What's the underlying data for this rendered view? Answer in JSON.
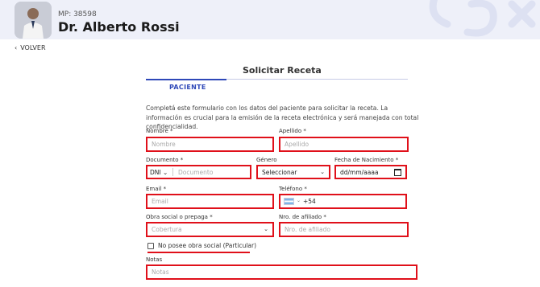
{
  "header": {
    "mp": "MP: 38598",
    "doctor_name": "Dr. Alberto Rossi"
  },
  "nav": {
    "back_label": "VOLVER"
  },
  "page": {
    "title": "Solicitar Receta",
    "active_tab": "PACIENTE",
    "intro": "Completá este formulario con los datos del paciente para solicitar la receta. La información es crucial para la emisión de la receta electrónica y será manejada con total confidencialidad."
  },
  "form": {
    "nombre": {
      "label": "Nombre *",
      "placeholder": "Nombre"
    },
    "apellido": {
      "label": "Apellido *",
      "placeholder": "Apellido"
    },
    "documento": {
      "label": "Documento *",
      "type_value": "DNI",
      "placeholder": "Documento"
    },
    "genero": {
      "label": "Género",
      "value": "Seleccionar"
    },
    "fecha": {
      "label": "Fecha de Nacimiento *",
      "value": "dd/mm/aaaa"
    },
    "email": {
      "label": "Email *",
      "placeholder": "Email"
    },
    "telefono": {
      "label": "Teléfono *",
      "value": "+54"
    },
    "obra_social": {
      "label": "Obra social o prepaga *",
      "placeholder": "Cobertura"
    },
    "afiliado": {
      "label": "Nro. de afiliado *",
      "placeholder": "Nro. de afiliado"
    },
    "no_obra_social": {
      "label": "No posee obra social (Particular)",
      "checked": false
    },
    "notas": {
      "label": "Notas",
      "placeholder": "Notas"
    }
  },
  "colors": {
    "accent": "#2e48b8",
    "error_border": "#e0101a",
    "header_bg": "#eef0f9"
  }
}
